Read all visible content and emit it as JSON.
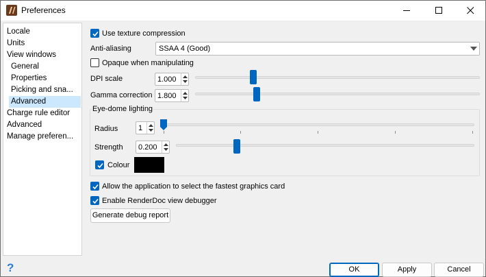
{
  "window": {
    "title": "Preferences"
  },
  "sidebar": {
    "items": [
      {
        "label": "Locale",
        "indent": 0,
        "selected": false
      },
      {
        "label": "Units",
        "indent": 0,
        "selected": false
      },
      {
        "label": "View windows",
        "indent": 0,
        "selected": false
      },
      {
        "label": "General",
        "indent": 1,
        "selected": false
      },
      {
        "label": "Properties",
        "indent": 1,
        "selected": false
      },
      {
        "label": "Picking and sna...",
        "indent": 1,
        "selected": false
      },
      {
        "label": "Advanced",
        "indent": 1,
        "selected": true
      },
      {
        "label": "Charge rule editor",
        "indent": 0,
        "selected": false
      },
      {
        "label": "Advanced",
        "indent": 0,
        "selected": false
      },
      {
        "label": "Manage preferen...",
        "indent": 0,
        "selected": false
      }
    ]
  },
  "settings": {
    "texture_compression": {
      "label": "Use texture compression",
      "checked": true
    },
    "anti_aliasing": {
      "label": "Anti-aliasing",
      "value": "SSAA 4 (Good)"
    },
    "opaque_manipulating": {
      "label": "Opaque when manipulating",
      "checked": false
    },
    "dpi_scale": {
      "label": "DPI scale",
      "value": "1.000",
      "slider_fraction": 0.2
    },
    "gamma_correction": {
      "label": "Gamma correction",
      "value": "1.800",
      "slider_fraction": 0.21
    },
    "eye_dome": {
      "title": "Eye-dome lighting",
      "radius": {
        "label": "Radius",
        "value": "1",
        "slider_fraction": 0.0
      },
      "strength": {
        "label": "Strength",
        "value": "0.200",
        "slider_fraction": 0.2
      },
      "colour": {
        "label": "Colour",
        "checked": true,
        "color": "#000000"
      }
    },
    "fastest_card": {
      "label": "Allow the application to select the fastest graphics card",
      "checked": true
    },
    "renderdoc": {
      "label": "Enable RenderDoc view debugger",
      "checked": true
    },
    "debug_report_label": "Generate debug report"
  },
  "buttons": {
    "ok": "OK",
    "apply": "Apply",
    "cancel": "Cancel"
  },
  "colors": {
    "accent": "#0067c0",
    "selection": "#cce8ff"
  }
}
